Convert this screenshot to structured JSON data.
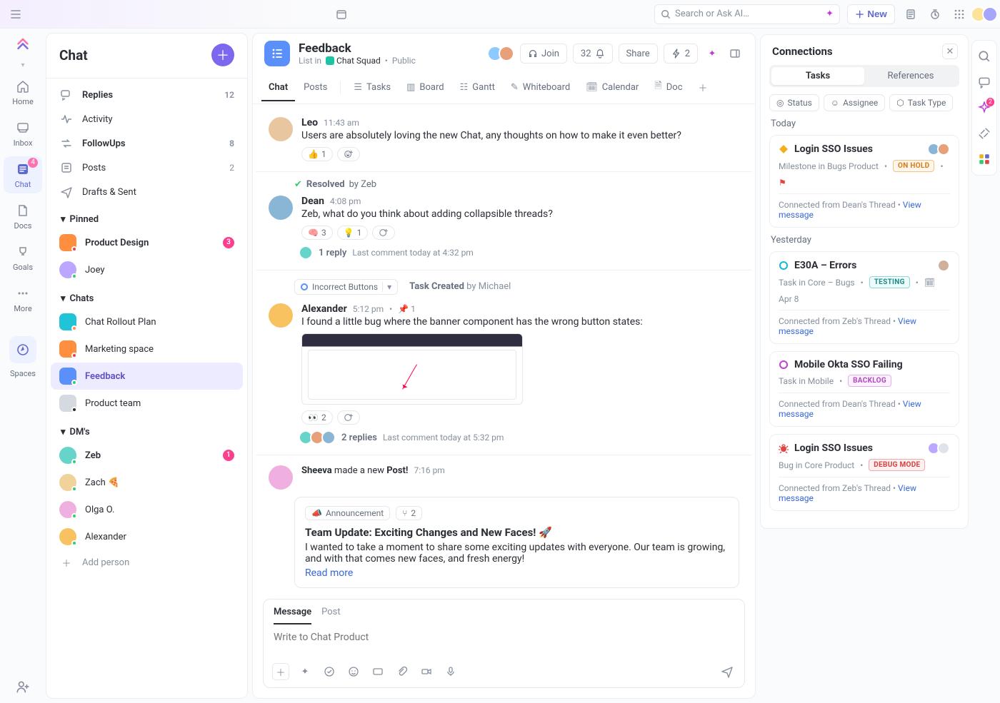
{
  "topbar": {
    "search_placeholder": "Search or Ask AI…",
    "new_label": "New"
  },
  "rail": {
    "items": [
      {
        "label": "Home"
      },
      {
        "label": "Inbox"
      },
      {
        "label": "Chat",
        "badge": "4"
      },
      {
        "label": "Docs"
      },
      {
        "label": "Goals"
      },
      {
        "label": "More"
      }
    ],
    "spaces_label": "Spaces"
  },
  "sidebar": {
    "title": "Chat",
    "sections": {
      "top": [
        {
          "label": "Replies",
          "count": "12",
          "bold": true
        },
        {
          "label": "Activity"
        },
        {
          "label": "FollowUps",
          "count": "8",
          "bold": true
        },
        {
          "label": "Posts",
          "count": "2"
        },
        {
          "label": "Drafts & Sent"
        }
      ],
      "pinned_title": "Pinned",
      "pinned": [
        {
          "label": "Product Design",
          "bold": true,
          "pill": "3"
        },
        {
          "label": "Joey"
        }
      ],
      "chats_title": "Chats",
      "chats": [
        {
          "label": "Chat Rollout Plan"
        },
        {
          "label": "Marketing space"
        },
        {
          "label": "Feedback",
          "active": true
        },
        {
          "label": "Product team"
        }
      ],
      "dms_title": "DM's",
      "dms": [
        {
          "label": "Zeb",
          "bold": true,
          "pill": "1"
        },
        {
          "label": "Zach 🍕"
        },
        {
          "label": "Olga O."
        },
        {
          "label": "Alexander"
        }
      ],
      "add_person": "Add person"
    }
  },
  "header": {
    "title": "Feedback",
    "subtitle_prefix": "List in",
    "folder": "Chat Squad",
    "visibility": "Public",
    "join": "Join",
    "member_count": "32",
    "share": "Share",
    "automations": "2"
  },
  "tabs": [
    {
      "label": "Chat",
      "active": true
    },
    {
      "label": "Posts"
    },
    {
      "label": "Tasks",
      "icon": "list"
    },
    {
      "label": "Board",
      "icon": "board"
    },
    {
      "label": "Gantt",
      "icon": "gantt"
    },
    {
      "label": "Whiteboard",
      "icon": "whiteboard"
    },
    {
      "label": "Calendar",
      "icon": "calendar"
    },
    {
      "label": "Doc",
      "icon": "doc"
    }
  ],
  "messages": {
    "m1": {
      "author": "Leo",
      "time": "11:43 am",
      "text": "Users are absolutely loving the new Chat, any thoughts on how to make it even better?",
      "react_emoji": "👍",
      "react_count": "1"
    },
    "resolved": {
      "prefix": "Resolved",
      "by": "by Zeb"
    },
    "m2": {
      "author": "Dean",
      "time": "4:08 pm",
      "text": "Zeb, what do you think about adding collapsible threads?",
      "r1_emoji": "🧠",
      "r1_count": "3",
      "r2_emoji": "💡",
      "r2_count": "1",
      "thread_count": "1 reply",
      "thread_last": "Last comment today at 4:32 pm"
    },
    "task": {
      "name": "Incorrect Buttons",
      "created_prefix": "Task Created",
      "created_by": "by Michael"
    },
    "m3": {
      "author": "Alexander",
      "time": "5:12 pm",
      "pin_count": "1",
      "text": "I found a little bug where the banner component has the wrong button states:",
      "react_emoji": "👀",
      "react_count": "2",
      "thread_count": "2 replies",
      "thread_last": "Last comment today at 5:32 pm"
    },
    "m4": {
      "author": "Sheeva",
      "verb": " made a new ",
      "kind": "Post!",
      "time": "7:16 pm",
      "chip_label": "Announcement",
      "chip2_count": "2",
      "title": "Team Update: Exciting Changes and New Faces! 🚀",
      "body": "I wanted to take a moment to share some exciting updates with everyone. Our team is growing, and with that comes new faces, and fresh energy!",
      "read_more": "Read more"
    }
  },
  "composer": {
    "tabs": {
      "message": "Message",
      "post": "Post"
    },
    "placeholder": "Write to Chat Product"
  },
  "connections": {
    "title": "Connections",
    "seg": {
      "tasks": "Tasks",
      "references": "References"
    },
    "filters": {
      "status": "Status",
      "assignee": "Assignee",
      "type": "Task Type"
    },
    "groups": {
      "today": "Today",
      "yesterday": "Yesterday"
    },
    "items": [
      {
        "group": "today",
        "icon_color": "#f2b01e",
        "title": "Login SSO Issues",
        "meta": "Milestone in Bugs Product",
        "status_label": "ON HOLD",
        "status_class": "onhold",
        "flag": true,
        "from": "Connected from Dean's Thread",
        "link": "View message"
      },
      {
        "group": "yesterday",
        "icon_color": "#17b9d1",
        "title": "E30A – Errors",
        "meta": "Task in Core – Bugs",
        "status_label": "TESTING",
        "status_class": "testing",
        "date": "Apr 8",
        "from": "Connected from Zeb's Thread",
        "link": "View message"
      },
      {
        "group": "yesterday",
        "icon_color": "#c13fd6",
        "title": "Mobile Okta SSO Failing",
        "meta": "Task in Mobile",
        "status_label": "BACKLOG",
        "status_class": "backlog",
        "from": "Connected from Dean's Thread",
        "link": "View message"
      },
      {
        "group": "yesterday",
        "icon_color": "#e24444",
        "bug": true,
        "title": "Login SSO Issues",
        "meta": "Bug in Core Product",
        "status_label": "DEBUG MODE",
        "status_class": "debug",
        "from": "Connected from Zeb's Thread",
        "link": "View message"
      }
    ]
  }
}
